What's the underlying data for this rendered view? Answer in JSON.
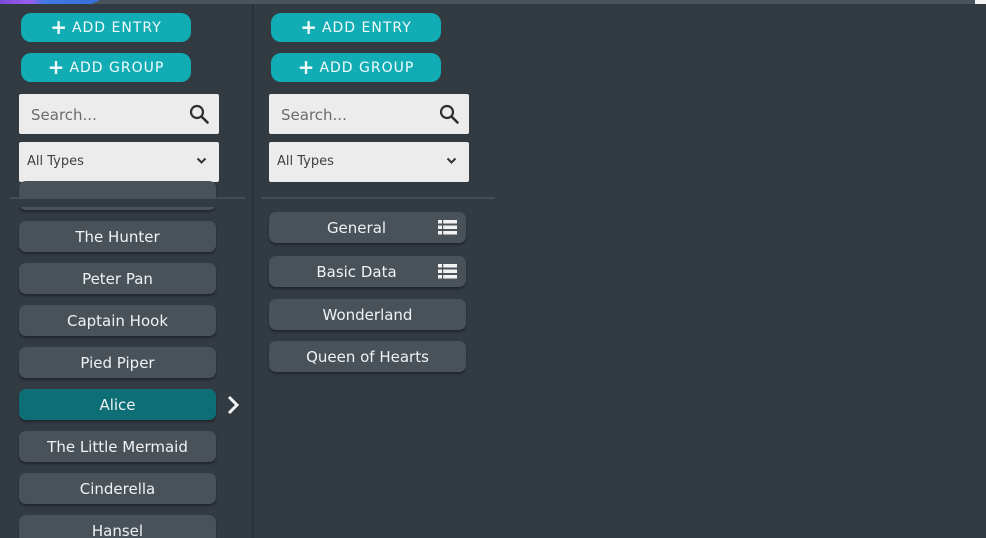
{
  "left_panel": {
    "add_entry_label": "ADD ENTRY",
    "add_group_label": "ADD GROUP",
    "search_placeholder": "Search...",
    "type_filter": "All Types",
    "items": [
      {
        "label": "The Hunter"
      },
      {
        "label": "Peter Pan"
      },
      {
        "label": "Captain Hook"
      },
      {
        "label": "Pied Piper"
      },
      {
        "label": "Alice",
        "selected": true
      },
      {
        "label": "The Little Mermaid"
      },
      {
        "label": "Cinderella"
      },
      {
        "label": "Hansel"
      }
    ]
  },
  "right_panel": {
    "add_entry_label": "ADD ENTRY",
    "add_group_label": "ADD GROUP",
    "search_placeholder": "Search...",
    "type_filter": "All Types",
    "items": [
      {
        "label": "General",
        "icon": "list-icon"
      },
      {
        "label": "Basic Data",
        "icon": "list-icon"
      },
      {
        "label": "Wonderland"
      },
      {
        "label": "Queen of Hearts"
      }
    ]
  },
  "colors": {
    "background": "#323a42",
    "accent_teal": "#12acb4",
    "selected_item": "#0e6e76",
    "item": "#495259"
  }
}
